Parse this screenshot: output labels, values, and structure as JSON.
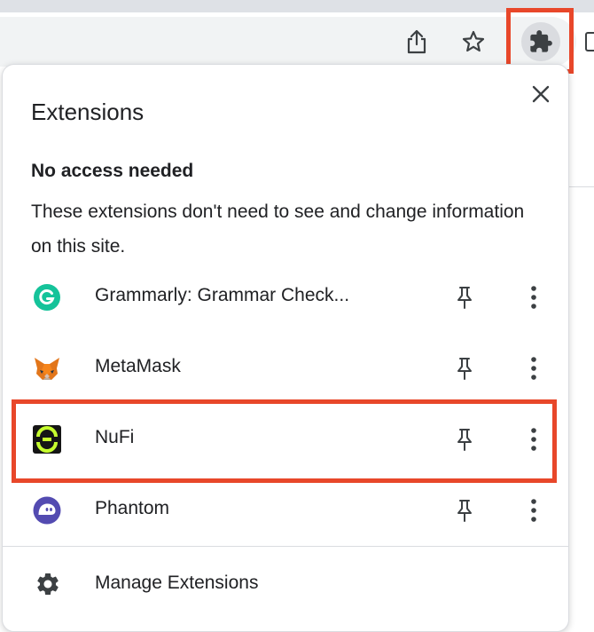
{
  "browser": {
    "toolbar_icons": [
      "share-icon",
      "bookmark-star-icon",
      "extensions-puzzle-icon",
      "side-panel-icon"
    ],
    "highlight_color": "#e8472a"
  },
  "popup": {
    "title": "Extensions",
    "close_icon": "close-icon",
    "section": {
      "heading": "No access needed",
      "description": "These extensions don't need to see and change information on this site."
    },
    "extensions": [
      {
        "name": "Grammarly: Grammar Check...",
        "icon": "grammarly-icon",
        "pinned": false
      },
      {
        "name": "MetaMask",
        "icon": "metamask-fox-icon",
        "pinned": false
      },
      {
        "name": "NuFi",
        "icon": "nufi-icon",
        "pinned": false,
        "highlighted": true
      },
      {
        "name": "Phantom",
        "icon": "phantom-ghost-icon",
        "pinned": false
      }
    ],
    "manage": {
      "label": "Manage Extensions",
      "icon": "gear-icon"
    }
  }
}
